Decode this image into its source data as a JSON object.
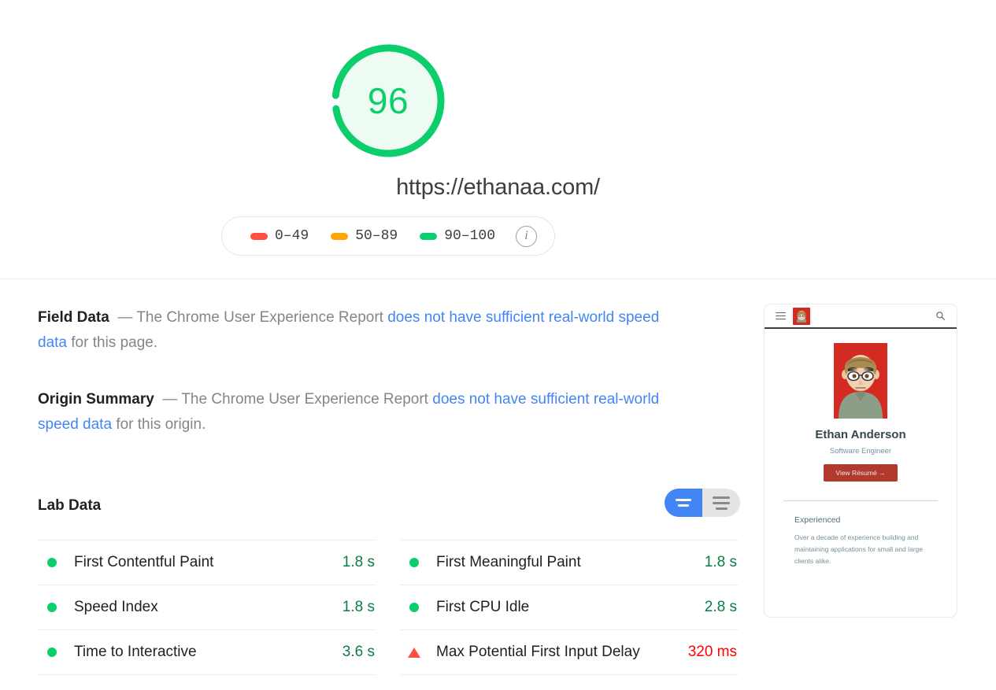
{
  "score": {
    "value": "96",
    "ring_color": "#0cce6b",
    "fill_color": "#eefbf3",
    "url": "https://ethanaa.com/"
  },
  "legend": {
    "items": [
      {
        "range": "0–49",
        "color": "#ff4e42",
        "icon": "fail-swatch"
      },
      {
        "range": "50–89",
        "color": "#ffa400",
        "icon": "average-swatch"
      },
      {
        "range": "90–100",
        "color": "#0cce6b",
        "icon": "pass-swatch"
      }
    ],
    "info_icon": "i",
    "info_icon_name": "info-icon"
  },
  "field_data": {
    "title": "Field Data",
    "dash": "—",
    "text_before": "The Chrome User Experience Report",
    "link": "does not have sufficient real-world speed data",
    "text_after": "for this page."
  },
  "origin_summary": {
    "title": "Origin Summary",
    "dash": "—",
    "text_before": "The Chrome User Experience Report",
    "link": "does not have sufficient real-world speed data",
    "text_after": "for this origin."
  },
  "lab_data": {
    "title": "Lab Data",
    "toggle": {
      "active": "two-column-view",
      "options": [
        "two-column-view",
        "single-column-view"
      ]
    },
    "columns": [
      {
        "metrics": [
          {
            "name": "First Contentful Paint",
            "value": "1.8 s",
            "status": "pass",
            "marker": "circle"
          },
          {
            "name": "Speed Index",
            "value": "1.8 s",
            "status": "pass",
            "marker": "circle"
          },
          {
            "name": "Time to Interactive",
            "value": "3.6 s",
            "status": "pass",
            "marker": "circle"
          }
        ]
      },
      {
        "metrics": [
          {
            "name": "First Meaningful Paint",
            "value": "1.8 s",
            "status": "pass",
            "marker": "circle"
          },
          {
            "name": "First CPU Idle",
            "value": "2.8 s",
            "status": "pass",
            "marker": "circle"
          },
          {
            "name": "Max Potential First Input Delay",
            "value": "320 ms",
            "status": "fail",
            "marker": "triangle"
          }
        ]
      }
    ]
  },
  "thumbnail": {
    "header": {
      "menu_icon": "hamburger-menu-icon",
      "logo": "site-avatar-logo",
      "search_icon": "search-icon"
    },
    "avatar_alt": "cartoon-portrait-avatar",
    "name": "Ethan Anderson",
    "role": "Software Engineer",
    "cta_label": "View Résumé →",
    "cta_color": "#b03a2e",
    "section_title": "Experienced",
    "section_body": "Over a decade of experience building and maintaining applications for small and large clients alike."
  }
}
